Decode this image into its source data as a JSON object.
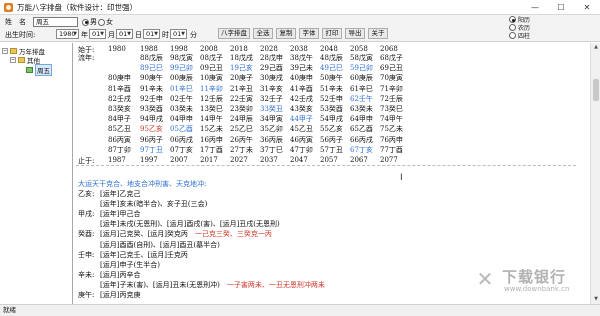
{
  "window": {
    "title": "万能八字排盘（软件设计：印世强）",
    "min": "—",
    "max": "☐",
    "close": "✕"
  },
  "form": {
    "name_label": "姓　名",
    "name_value": "周五",
    "male_label": "男",
    "female_label": "女",
    "birth_label": "出生时间:",
    "year": "1980",
    "year_unit": "年",
    "month": "01",
    "month_unit": "月",
    "day": "01",
    "day_unit": "日",
    "hour": "01",
    "hour_unit": "时",
    "minute": "01",
    "minute_unit": "分",
    "buttons": [
      "八字排盘",
      "全选",
      "复制",
      "字体",
      "打印",
      "导出",
      "关于"
    ],
    "calendar_options": [
      "阳历",
      "农历",
      "四柱"
    ],
    "calendar_selected": 0
  },
  "sidebar": {
    "root": "万年排盘",
    "child": "其他",
    "leaf": "周五"
  },
  "table": {
    "start_label": "始于:",
    "flow_label": "流年:",
    "end_label": "止于:",
    "start_years": [
      "1980",
      "1988",
      "1998",
      "2008",
      "2018",
      "2028",
      "2038",
      "2048",
      "2058",
      "2068"
    ],
    "end_years": [
      "1987",
      "1997",
      "2007",
      "2017",
      "2027",
      "2037",
      "2047",
      "2057",
      "2067",
      "2077"
    ],
    "columns": [
      [
        "80庚申",
        "81辛酉",
        "82壬戌",
        "83癸亥",
        "84甲子",
        "85乙丑",
        "86丙寅",
        "87丁卯"
      ],
      [
        "88戊辰",
        "89己巳",
        "90庚午",
        "91辛未",
        "92壬申",
        "93癸酉",
        "94甲戌",
        "95乙亥",
        "96丙子",
        "97丁丑"
      ],
      [
        "98戊寅",
        "99己卯",
        "00庚辰",
        "01辛巳",
        "02壬午",
        "03癸未",
        "04甲申",
        "05乙酉",
        "06丙戌",
        "07丁亥"
      ],
      [
        "08戊子",
        "09己丑",
        "10庚寅",
        "11辛卯",
        "12壬辰",
        "13癸巳",
        "14甲午",
        "15乙未",
        "16丙申",
        "17丁酉"
      ],
      [
        "18戊戌",
        "19己亥",
        "20庚子",
        "21辛丑",
        "22壬寅",
        "23癸卯",
        "24甲辰",
        "25乙巳",
        "26丙午",
        "27丁未"
      ],
      [
        "28戊申",
        "29己酉",
        "30庚戌",
        "31辛亥",
        "32壬子",
        "33癸丑",
        "34甲寅",
        "35乙卯",
        "36丙辰",
        "37丁巳"
      ],
      [
        "38戊午",
        "39己未",
        "40庚申",
        "41辛酉",
        "42壬戌",
        "43癸亥",
        "44甲子",
        "45乙丑",
        "46丙寅",
        "47丁卯"
      ],
      [
        "48戊辰",
        "49己巳",
        "50庚午",
        "51辛未",
        "52壬申",
        "53癸酉",
        "54甲戌",
        "55乙亥",
        "56丙子",
        "57丁丑"
      ],
      [
        "58戊寅",
        "59己卯",
        "60庚辰",
        "61辛巳",
        "62壬午",
        "63癸未",
        "64甲申",
        "65乙酉",
        "66丙戌",
        "67丁亥"
      ],
      [
        "68戊子",
        "69己丑",
        "70庚寅",
        "71辛卯",
        "72壬辰",
        "73癸巳",
        "74甲午",
        "75乙未",
        "76丙申",
        "77丁酉"
      ]
    ],
    "column_offsets": [
      2,
      0,
      0,
      0,
      0,
      0,
      0,
      0,
      0,
      0
    ],
    "highlight_blue": [
      [
        1,
        1
      ],
      [
        2,
        1
      ],
      [
        2,
        3
      ],
      [
        2,
        7
      ],
      [
        3,
        3
      ],
      [
        4,
        1
      ],
      [
        5,
        5
      ],
      [
        6,
        6
      ],
      [
        7,
        1
      ],
      [
        8,
        1
      ],
      [
        8,
        4
      ],
      [
        8,
        9
      ],
      [
        1,
        9
      ]
    ],
    "highlight_red": [
      [
        1,
        7
      ]
    ]
  },
  "notes": {
    "heading": "大运天干克合、地支合冲刑害、天克地冲:",
    "lines": [
      {
        "label": "乙亥:",
        "parts": [
          {
            "t": "[运年]乙克己"
          }
        ]
      },
      {
        "label": "",
        "parts": [
          {
            "t": "[运年]亥未(暗半合)、亥子丑(三会)"
          }
        ]
      },
      {
        "label": "甲戌:",
        "parts": [
          {
            "t": "[运年]甲己合"
          }
        ]
      },
      {
        "label": "",
        "parts": [
          {
            "t": "[运年]未戌(无恩刑)、[运月]酉戌(害)、[运月]丑戌(无恩刑)"
          }
        ]
      },
      {
        "label": "癸酉:",
        "parts": [
          {
            "t": "[运月]己克癸、[运月]癸克丙　"
          },
          {
            "t": "一己克三癸、三癸克一丙",
            "c": "red"
          }
        ]
      },
      {
        "label": "",
        "parts": [
          {
            "t": "[运月]酉酉(自刑)、[运月]酉丑(墓半合)"
          }
        ]
      },
      {
        "label": "壬申:",
        "parts": [
          {
            "t": "[运年]己克壬、[运月]壬克丙"
          }
        ]
      },
      {
        "label": "",
        "parts": [
          {
            "t": "[运月]申子(生半合)"
          }
        ]
      },
      {
        "label": "辛未:",
        "parts": [
          {
            "t": "[运月]丙辛合"
          }
        ]
      },
      {
        "label": "",
        "parts": [
          {
            "t": "[运年]子未(害)、[运月]丑未(无恩刑冲)　"
          },
          {
            "t": "一子害两未、一丑无恩刑冲两未",
            "c": "red"
          }
        ]
      },
      {
        "label": "庚午:",
        "parts": [
          {
            "t": "[运月]丙克庚"
          }
        ]
      }
    ]
  },
  "status": "就绪",
  "watermark": {
    "logo": "✕",
    "name": "下载银行",
    "url": "www.downbank.cn"
  }
}
